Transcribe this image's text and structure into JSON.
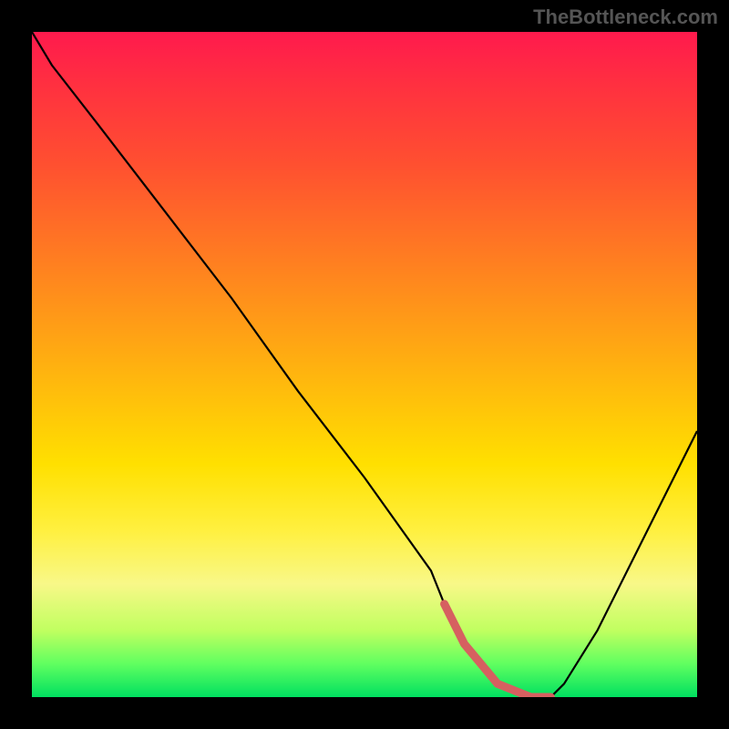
{
  "watermark": "TheBottleneck.com",
  "chart_data": {
    "type": "line",
    "title": "",
    "xlabel": "",
    "ylabel": "",
    "xlim": [
      0,
      100
    ],
    "ylim": [
      0,
      100
    ],
    "x": [
      0,
      3,
      10,
      20,
      30,
      40,
      50,
      60,
      62,
      65,
      70,
      75,
      78,
      80,
      85,
      90,
      95,
      100
    ],
    "y": [
      100,
      95,
      86,
      73,
      60,
      46,
      33,
      19,
      14,
      8,
      2,
      0,
      0,
      2,
      10,
      20,
      30,
      40
    ],
    "optimal_zone": {
      "x_start": 62,
      "x_end": 78,
      "y_start": 14,
      "y_end": 2
    },
    "background_gradient": {
      "top": "#ff1a4d",
      "mid_top": "#ff8020",
      "mid": "#ffe000",
      "mid_bottom": "#c0ff60",
      "bottom": "#00e060"
    }
  }
}
